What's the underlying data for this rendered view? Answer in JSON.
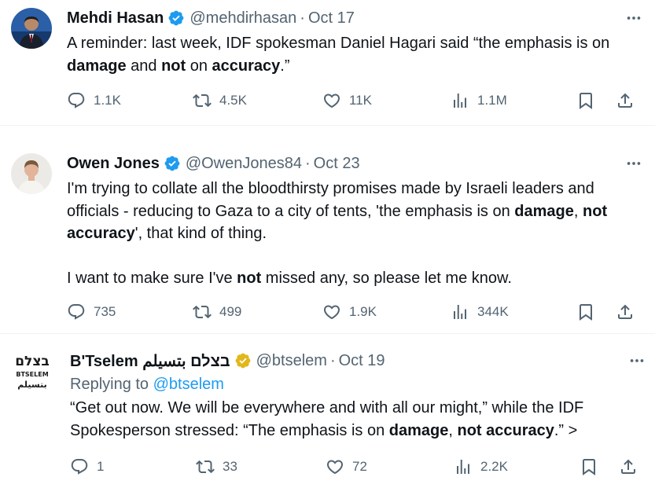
{
  "tweets": [
    {
      "name": "Mehdi Hasan",
      "handle": "@mehdirhasan",
      "sep": "·",
      "date": "Oct 17",
      "verified": "blue",
      "lines": [
        [
          {
            "t": "A reminder: last week, IDF spokesman Daniel Hagari said “the emphasis is on"
          }
        ],
        [
          {
            "t": "damage",
            "b": true
          },
          {
            "t": " and "
          },
          {
            "t": "not",
            "b": true
          },
          {
            "t": " on "
          },
          {
            "t": "accuracy",
            "b": true
          },
          {
            "t": ".”"
          }
        ]
      ],
      "replies": "1.1K",
      "retweets": "4.5K",
      "likes": "11K",
      "views": "1.1M"
    },
    {
      "name": "Owen Jones",
      "handle": "@OwenJones84",
      "sep": "·",
      "date": "Oct 23",
      "verified": "blue",
      "lines": [
        [
          {
            "t": "I'm trying to collate all the bloodthirsty promises made by Israeli leaders and"
          }
        ],
        [
          {
            "t": "officials - reducing to Gaza to a city of tents, 'the emphasis is on "
          },
          {
            "t": "damage",
            "b": true
          },
          {
            "t": ", "
          },
          {
            "t": "not",
            "b": true
          }
        ],
        [
          {
            "t": "accuracy",
            "b": true
          },
          {
            "t": "', that kind of thing."
          }
        ],
        [],
        [
          {
            "t": "I want to make sure I've "
          },
          {
            "t": "not",
            "b": true
          },
          {
            "t": " missed any, so please let me know."
          }
        ]
      ],
      "replies": "735",
      "retweets": "499",
      "likes": "1.9K",
      "views": "344K"
    },
    {
      "name": "B'Tselem בצלם بتسيلم",
      "handle": "@btselem",
      "sep": "·",
      "date": "Oct 19",
      "verified": "gold",
      "replying_prefix": "Replying to ",
      "replying_handle": "@btselem",
      "lines": [
        [
          {
            "t": "“Get out now. We will be everywhere and with all our might,” while the IDF"
          }
        ],
        [
          {
            "t": "Spokesperson stressed: “The emphasis is on "
          },
          {
            "t": "damage",
            "b": true
          },
          {
            "t": ", "
          },
          {
            "t": "not accuracy",
            "b": true
          },
          {
            "t": ".” >"
          }
        ]
      ],
      "replies": "1",
      "retweets": "33",
      "likes": "72",
      "views": "2.2K",
      "logo_text": {
        "hebrew": "בצלם",
        "latin": "BTSELEM",
        "arabic": "بتسيلم"
      }
    }
  ],
  "colors": {
    "text": "#0f1419",
    "muted": "#536471",
    "link": "#1d9bf0",
    "verified_blue": "#1d9bf0",
    "verified_gold": "#e2b719"
  },
  "icons": [
    "verified-icon",
    "more-icon",
    "reply-icon",
    "retweet-icon",
    "like-icon",
    "views-icon",
    "bookmark-icon",
    "share-icon"
  ]
}
